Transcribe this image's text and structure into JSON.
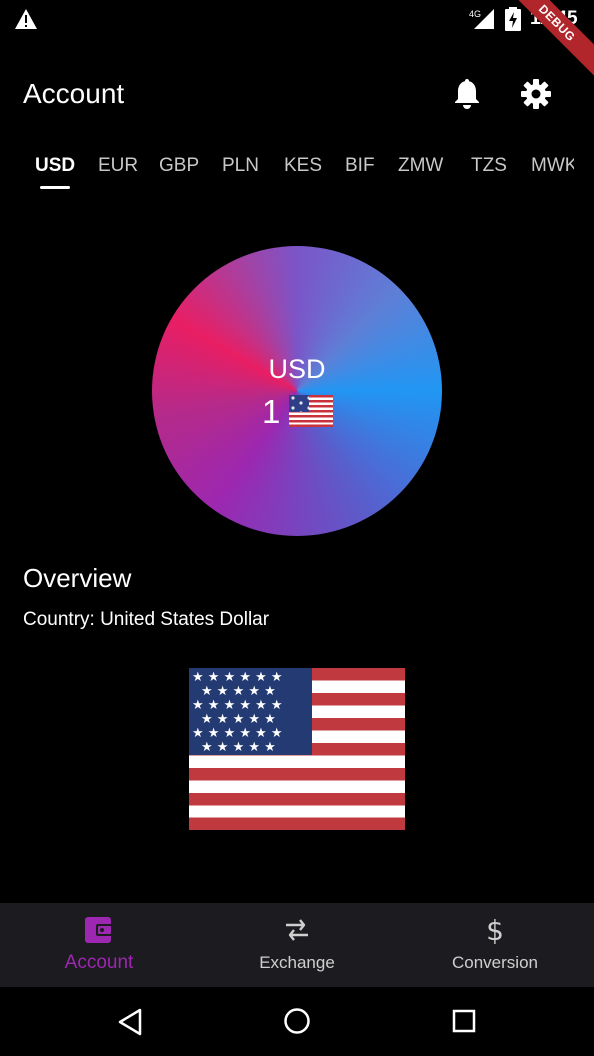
{
  "status_bar": {
    "time": "11:45",
    "network": "4G",
    "debug_banner": "DEBUG",
    "icons": [
      "warning-icon",
      "signal-icon",
      "battery-charging-icon"
    ]
  },
  "app_bar": {
    "title": "Account",
    "icons": [
      "bell-icon",
      "gear-icon"
    ]
  },
  "tabs": [
    {
      "label": "USD",
      "active": true
    },
    {
      "label": "EUR"
    },
    {
      "label": "GBP"
    },
    {
      "label": "PLN"
    },
    {
      "label": "KES"
    },
    {
      "label": "BIF"
    },
    {
      "label": "ZMW"
    },
    {
      "label": "TZS"
    },
    {
      "label": "MWK"
    }
  ],
  "currency_card": {
    "code": "USD",
    "amount": "1",
    "flag_icon": "us-flag-icon"
  },
  "overview": {
    "title": "Overview",
    "country_line": "Country: United States Dollar",
    "flag_icon": "us-flag-icon"
  },
  "bottom_nav": [
    {
      "label": "Account",
      "icon": "wallet-icon",
      "active": true
    },
    {
      "label": "Exchange",
      "icon": "swap-arrows-icon"
    },
    {
      "label": "Conversion",
      "icon": "dollar-icon"
    }
  ],
  "system_nav": [
    "back-icon",
    "home-icon",
    "recents-icon"
  ],
  "colors": {
    "background": "#000000",
    "accent": "#9c27b0",
    "nav_background": "#1c1b1f",
    "gradient": [
      "#e91e63",
      "#9c27b0",
      "#2196f3"
    ]
  }
}
